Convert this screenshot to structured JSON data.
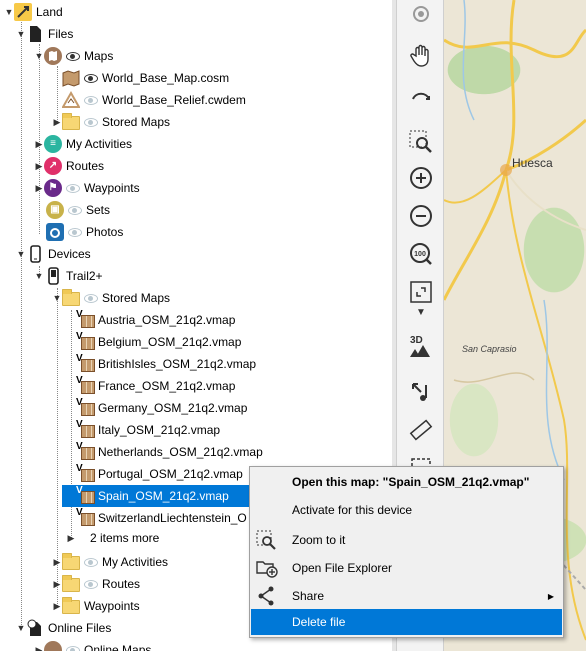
{
  "tree": {
    "land": "Land",
    "files": "Files",
    "maps": "Maps",
    "world_base_map": "World_Base_Map.cosm",
    "world_base_relief": "World_Base_Relief.cwdem",
    "stored_maps": "Stored Maps",
    "my_activities": "My Activities",
    "routes": "Routes",
    "waypoints": "Waypoints",
    "sets": "Sets",
    "photos": "Photos",
    "devices": "Devices",
    "trail2": "Trail2+",
    "device_stored_maps": "Stored Maps",
    "device_maps": [
      "Austria_OSM_21q2.vmap",
      "Belgium_OSM_21q2.vmap",
      "BritishIsles_OSM_21q2.vmap",
      "France_OSM_21q2.vmap",
      "Germany_OSM_21q2.vmap",
      "Italy_OSM_21q2.vmap",
      "Netherlands_OSM_21q2.vmap",
      "Portugal_OSM_21q2.vmap",
      "Spain_OSM_21q2.vmap",
      "SwitzerlandLiechtenstein_O"
    ],
    "more_items": "2 items more",
    "device_my_activities": "My Activities",
    "device_routes": "Routes",
    "device_waypoints": "Waypoints",
    "online_files": "Online Files",
    "online_maps": "Online Maps"
  },
  "menu": {
    "open_map": "Open this map: \"Spain_OSM_21q2.vmap\"",
    "activate": "Activate for this device",
    "zoom": "Zoom to it",
    "explorer": "Open File Explorer",
    "share": "Share",
    "delete": "Delete file"
  },
  "map": {
    "city": "Huesca",
    "place": "San Caprasio"
  },
  "toolbar": {
    "three_d": "3D"
  },
  "colors": {
    "selection": "#0078d7",
    "maps_icon": "#a0785a",
    "activities_icon": "#2bb5a0",
    "routes_icon": "#e0306a",
    "waypoints_icon": "#6a2a8a",
    "sets_icon": "#c8b24a",
    "photos_icon": "#1f6fb2"
  }
}
